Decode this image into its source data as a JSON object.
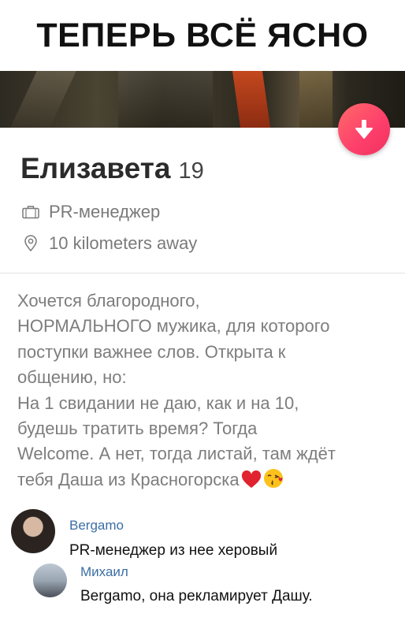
{
  "caption": "ТЕПЕРЬ ВСЁ ЯСНО",
  "profile": {
    "name": "Елизавета",
    "age": "19",
    "job": "PR-менеджер",
    "distance": "10 kilometers away",
    "bio_lines": [
      "Хочется благородного,",
      "НОРМАЛЬНОГО мужика, для которого",
      "поступки важнее слов. Открыта к",
      "общению, но:",
      "На 1 свидании не даю, как и на 10,",
      "будешь тратить время? Тогда",
      "Welcome. А нет, тогда листай, там ждёт",
      "тебя Даша из Красногорска"
    ],
    "bio_emojis": [
      "red-heart",
      "face-blowing-kiss"
    ]
  },
  "comments": [
    {
      "author": "Bergamo",
      "text": "PR-менеджер из нее херовый"
    },
    {
      "author": "Михаил",
      "text": "Bergamo, она рекламирует Дашу."
    }
  ],
  "colors": {
    "accent_button": "#fd3e6b",
    "comment_author": "#3b6ea5",
    "muted_text": "#7d7d7d"
  },
  "icons": [
    "arrow-down-icon",
    "briefcase-icon",
    "location-pin-icon"
  ]
}
